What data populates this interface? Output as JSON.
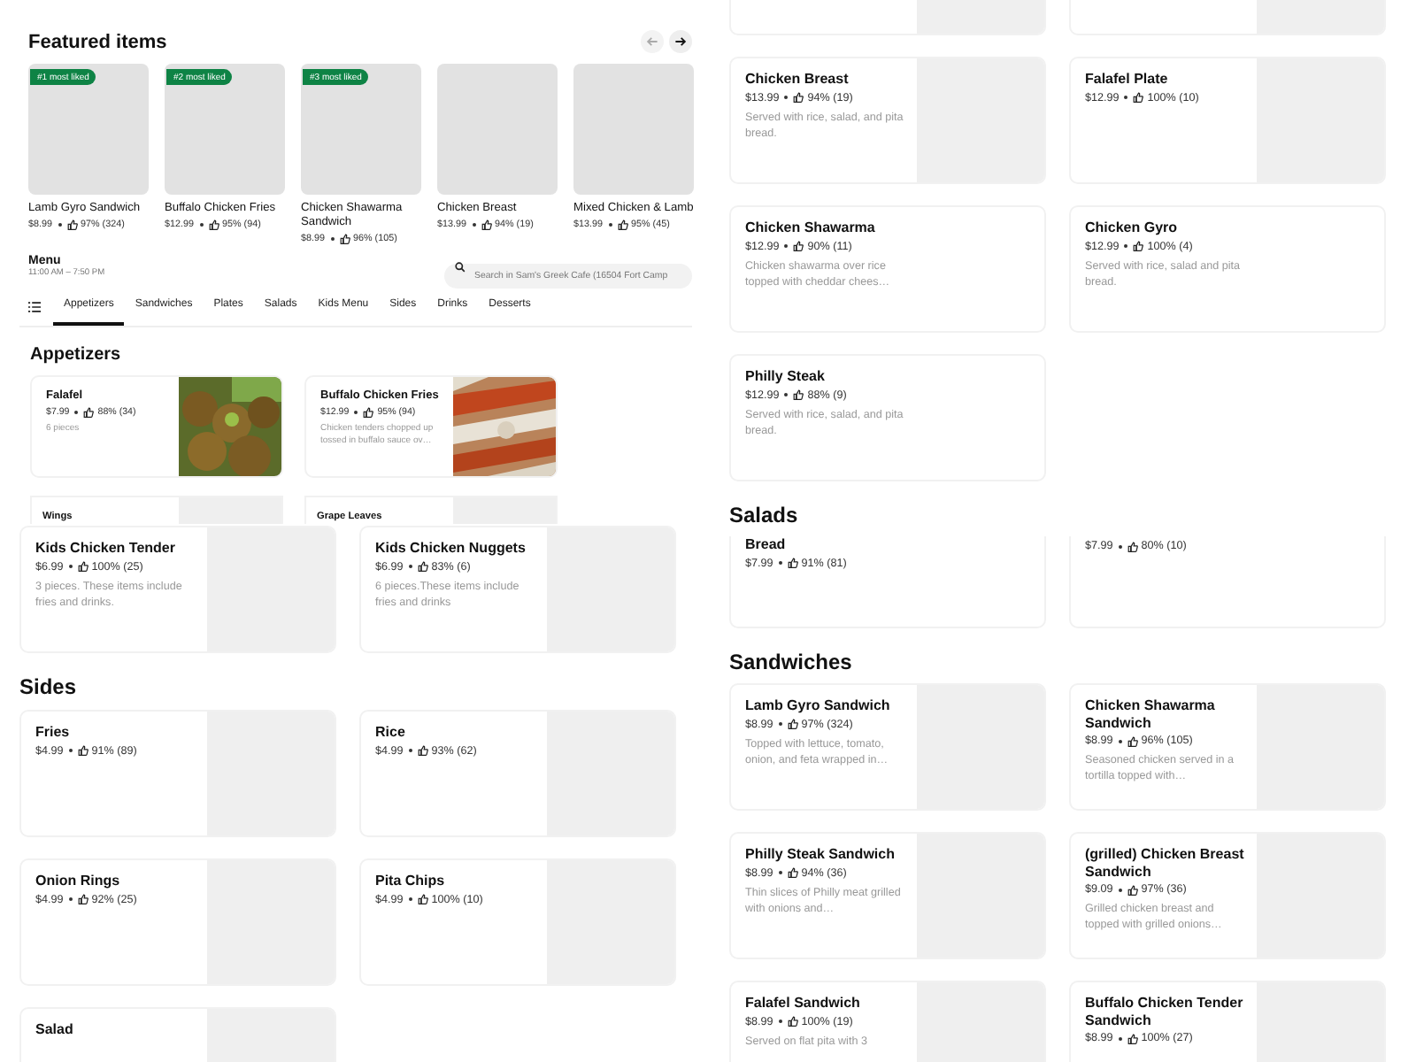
{
  "featured": {
    "title": "Featured items",
    "nav": [
      {
        "kind": "prev",
        "disabled": true
      },
      {
        "kind": "next",
        "disabled": false
      }
    ],
    "items": [
      {
        "badge": "#1 most liked",
        "name": "Lamb Gyro Sandwich",
        "price": "$8.99",
        "rating": "97% (324)"
      },
      {
        "badge": "#2 most liked",
        "name": "Buffalo Chicken Fries",
        "price": "$12.99",
        "rating": "95% (94)"
      },
      {
        "badge": "#3 most liked",
        "name": "Chicken Shawarma Sandwich",
        "price": "$8.99",
        "rating": "96% (105)"
      },
      {
        "name": "Chicken Breast",
        "price": "$13.99",
        "rating": "94% (19)"
      },
      {
        "name": "Mixed Chicken & Lamb",
        "price": "$13.99",
        "rating": "95% (45)"
      }
    ]
  },
  "menu": {
    "title": "Menu",
    "hours": "11:00 AM – 7:50 PM",
    "search": {
      "placeholder": "Search in Sam's Greek Cafe (16504 Fort Camp"
    },
    "tabs": [
      {
        "label": "Appetizers",
        "selected": true
      },
      {
        "label": "Sandwiches",
        "selected": false
      },
      {
        "label": "Plates",
        "selected": false
      },
      {
        "label": "Salads",
        "selected": false
      },
      {
        "label": "Kids Menu",
        "selected": false
      },
      {
        "label": "Sides",
        "selected": false
      },
      {
        "label": "Drinks",
        "selected": false
      },
      {
        "label": "Desserts",
        "selected": false
      }
    ]
  },
  "left_blocks": [
    {
      "kind": "subheading",
      "text": "Appetizers"
    },
    {
      "kind": "photo-cards",
      "items": [
        {
          "name": "Falafel",
          "price": "$7.99",
          "rating": "88% (34)",
          "description": "6 pieces"
        },
        {
          "name": "Buffalo Chicken Fries",
          "price": "$12.99",
          "rating": "95% (94)",
          "description": "Chicken tenders chopped up tossed in buffalo sauce ov…"
        }
      ]
    },
    {
      "kind": "strip",
      "items": [
        {
          "name": "Wings"
        },
        {
          "name": "Grape Leaves"
        }
      ]
    },
    {
      "kind": "cards",
      "items": [
        {
          "name": "Kids Chicken Tender",
          "price": "$6.99",
          "rating": "100% (25)",
          "description": "3 pieces. These items include fries and drinks."
        },
        {
          "name": "Kids Chicken Nuggets",
          "price": "$6.99",
          "rating": "83% (6)",
          "description": "6 pieces.These items include fries and drinks"
        }
      ]
    },
    {
      "kind": "heading",
      "text": "Sides"
    },
    {
      "kind": "cards",
      "items": [
        {
          "name": "Fries",
          "price": "$4.99",
          "rating": "91% (89)"
        },
        {
          "name": "Rice",
          "price": "$4.99",
          "rating": "93% (62)"
        },
        {
          "name": "Onion Rings",
          "price": "$4.99",
          "rating": "92% (25)"
        },
        {
          "name": "Pita Chips",
          "price": "$4.99",
          "rating": "100% (10)"
        },
        {
          "name": "Salad"
        }
      ]
    }
  ],
  "right_blocks": [
    {
      "kind": "sliver"
    },
    {
      "kind": "cards",
      "items": [
        {
          "name": "Chicken Breast",
          "price": "$13.99",
          "rating": "94% (19)",
          "description": "Served with rice, salad, and pita bread."
        },
        {
          "name": "Falafel Plate",
          "price": "$12.99",
          "rating": "100% (10)"
        },
        {
          "name": "Chicken Shawarma",
          "price": "$12.99",
          "rating": "90% (11)",
          "description": "Chicken shawarma over rice topped with cheddar chees…",
          "kind": "plain"
        },
        {
          "name": "Chicken Gyro",
          "price": "$12.99",
          "rating": "100% (4)",
          "description": "Served with rice, salad and pita bread.",
          "kind": "plain"
        },
        {
          "name": "Philly Steak",
          "price": "$12.99",
          "rating": "88% (9)",
          "description": "Served with rice, salad, and pita bread.",
          "kind": "plain"
        }
      ]
    },
    {
      "kind": "heading",
      "text": "Salads"
    },
    {
      "kind": "short-cards",
      "items": [
        {
          "name": "Bread",
          "price": "$7.99",
          "rating": "91% (81)",
          "kind": "plain"
        },
        {
          "price": "$7.99",
          "rating": "80% (10)",
          "kind": "plain"
        }
      ]
    },
    {
      "kind": "heading",
      "text": "Sandwiches"
    },
    {
      "kind": "cards",
      "items": [
        {
          "name": "Lamb Gyro Sandwich",
          "price": "$8.99",
          "rating": "97% (324)",
          "description": "Topped with lettuce, tomato, onion, and feta wrapped in…"
        },
        {
          "name": "Chicken Shawarma Sandwich",
          "price": "$8.99",
          "rating": "96% (105)",
          "description": "Seasoned chicken served in a tortilla topped with…"
        },
        {
          "name": "Philly Steak Sandwich",
          "price": "$8.99",
          "rating": "94% (36)",
          "description": "Thin slices of Philly meat grilled with onions and…"
        },
        {
          "name": "(grilled) Chicken Breast Sandwich",
          "price": "$9.09",
          "rating": "97% (36)",
          "description": "Grilled chicken breast and topped with grilled onions…"
        },
        {
          "name": "Falafel Sandwich",
          "price": "$8.99",
          "rating": "100% (19)",
          "description": "Served on flat pita with 3"
        },
        {
          "name": "Buffalo Chicken Tender Sandwich",
          "price": "$8.99",
          "rating": "100% (27)"
        }
      ]
    }
  ]
}
